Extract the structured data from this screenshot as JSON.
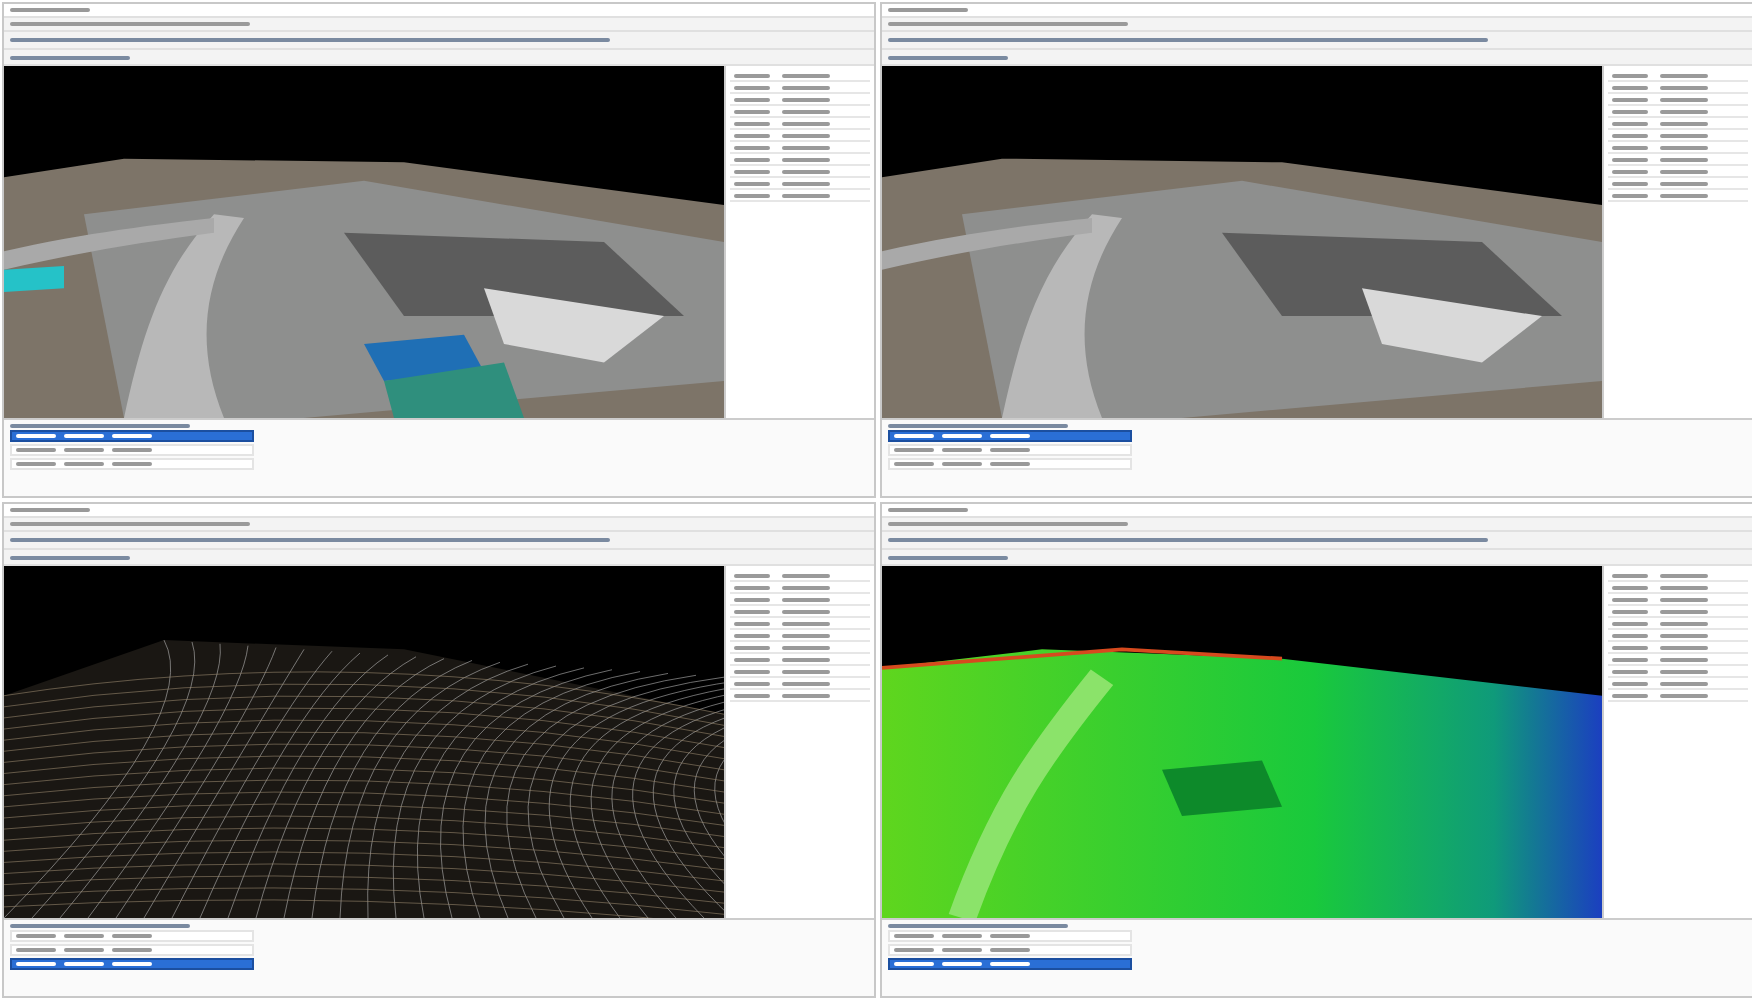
{
  "windows": [
    {
      "kind": "photo",
      "table_rows": [
        {
          "selected": true
        },
        {
          "selected": false
        },
        {
          "selected": false
        }
      ]
    },
    {
      "kind": "clean",
      "table_rows": [
        {
          "selected": true
        },
        {
          "selected": false
        },
        {
          "selected": false
        }
      ]
    },
    {
      "kind": "wireframe",
      "table_rows": [
        {
          "selected": false
        },
        {
          "selected": false
        },
        {
          "selected": true
        }
      ]
    },
    {
      "kind": "heightmap",
      "table_rows": [
        {
          "selected": false
        },
        {
          "selected": false
        },
        {
          "selected": true
        }
      ]
    }
  ]
}
